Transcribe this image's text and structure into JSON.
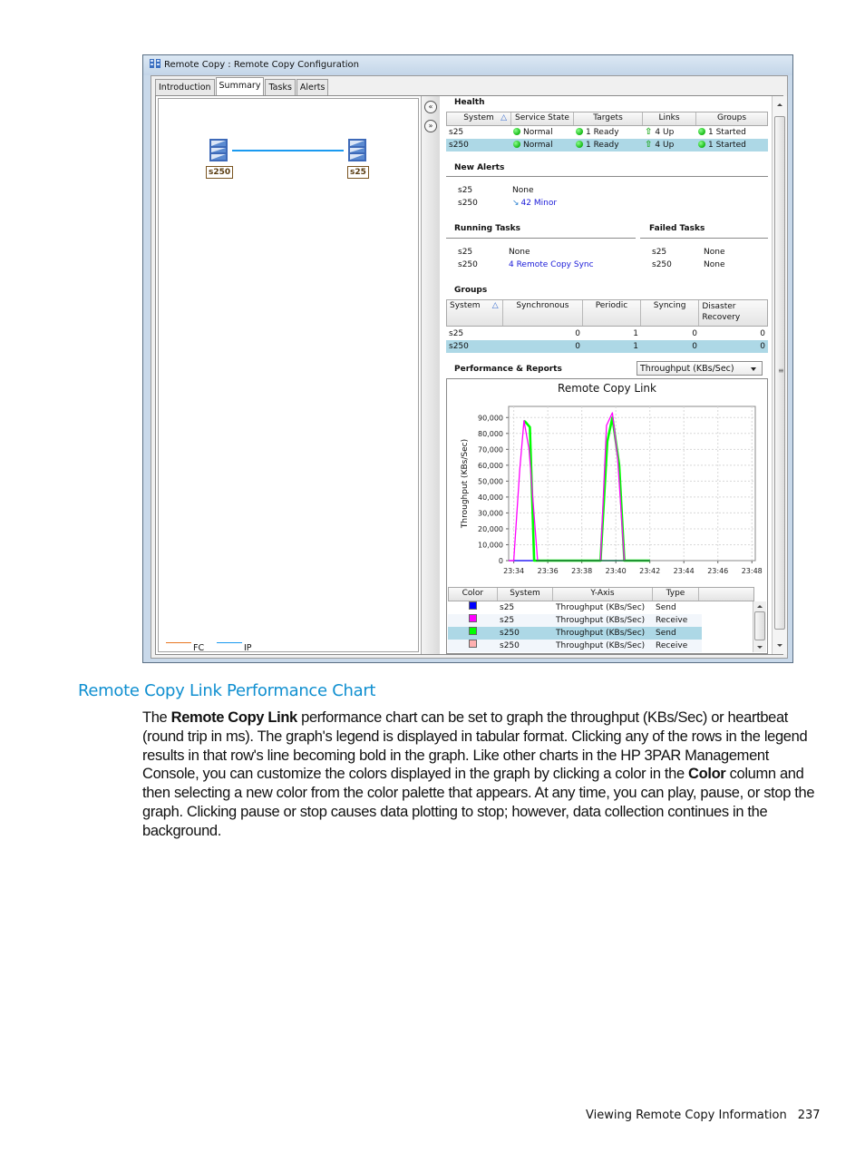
{
  "window": {
    "title": "Remote Copy : Remote Copy Configuration",
    "tabs": [
      {
        "label": "Introduction",
        "active": false
      },
      {
        "label": "Summary",
        "active": true
      },
      {
        "label": "Tasks",
        "active": false
      },
      {
        "label": "Alerts",
        "active": false
      }
    ]
  },
  "topology": {
    "nodes": [
      {
        "label": "s250"
      },
      {
        "label": "s25"
      }
    ],
    "link_type": "IP",
    "legend": [
      {
        "label": "FC",
        "color": "#e87722"
      },
      {
        "label": "IP",
        "color": "#1a9af0"
      }
    ]
  },
  "health": {
    "title": "Health",
    "columns": [
      "System",
      "Service State",
      "Targets",
      "Links",
      "Groups"
    ],
    "rows": [
      {
        "system": "s25",
        "service_state": "Normal",
        "targets": "1 Ready",
        "links": "4 Up",
        "groups": "1 Started",
        "selected": false
      },
      {
        "system": "s250",
        "service_state": "Normal",
        "targets": "1 Ready",
        "links": "4 Up",
        "groups": "1 Started",
        "selected": true
      }
    ]
  },
  "new_alerts": {
    "title": "New Alerts",
    "rows": [
      {
        "system": "s25",
        "value": "None"
      },
      {
        "system": "s250",
        "value": "42 Minor"
      }
    ]
  },
  "running_tasks": {
    "title": "Running Tasks",
    "rows": [
      {
        "system": "s25",
        "value": "None"
      },
      {
        "system": "s250",
        "value": "4 Remote Copy Sync"
      }
    ]
  },
  "failed_tasks": {
    "title": "Failed Tasks",
    "rows": [
      {
        "system": "s25",
        "value": "None"
      },
      {
        "system": "s250",
        "value": "None"
      }
    ]
  },
  "groups": {
    "title": "Groups",
    "columns": [
      "System",
      "Synchronous",
      "Periodic",
      "Syncing",
      "Disaster Recovery"
    ],
    "rows": [
      {
        "system": "s25",
        "synchronous": "0",
        "periodic": "1",
        "syncing": "0",
        "disaster_recovery": "0",
        "selected": false
      },
      {
        "system": "s250",
        "synchronous": "0",
        "periodic": "1",
        "syncing": "0",
        "disaster_recovery": "0",
        "selected": true
      }
    ]
  },
  "performance": {
    "title": "Performance & Reports",
    "metric_select": "Throughput (KBs/Sec)",
    "legend_columns": [
      "Color",
      "System",
      "Y-Axis",
      "Type"
    ],
    "legend_rows": [
      {
        "color": "#0000ff",
        "system": "s25",
        "y_axis": "Throughput (KBs/Sec)",
        "type": "Send",
        "selected": false
      },
      {
        "color": "#ff00ff",
        "system": "s25",
        "y_axis": "Throughput (KBs/Sec)",
        "type": "Receive",
        "selected": false
      },
      {
        "color": "#00ff00",
        "system": "s250",
        "y_axis": "Throughput (KBs/Sec)",
        "type": "Send",
        "selected": true
      },
      {
        "color": "#ffb0b0",
        "system": "s250",
        "y_axis": "Throughput (KBs/Sec)",
        "type": "Receive",
        "selected": false
      }
    ]
  },
  "chart_data": {
    "type": "line",
    "title": "Remote Copy Link",
    "xlabel": "",
    "ylabel": "Throughput (KBs/Sec)",
    "x_ticks": [
      "23:34",
      "23:36",
      "23:38",
      "23:40",
      "23:42",
      "23:44",
      "23:46",
      "23:48"
    ],
    "y_ticks": [
      "0",
      "10,000",
      "20,000",
      "30,000",
      "40,000",
      "50,000",
      "60,000",
      "70,000",
      "80,000",
      "90,000"
    ],
    "xlim_minutes": [
      33.7,
      48.2
    ],
    "ylim": [
      0,
      97000
    ],
    "grid": true,
    "legend": "table-below",
    "series": [
      {
        "name": "s25 Send",
        "color": "#0000ff",
        "x_minutes": [
          33.7,
          42.0
        ],
        "values": [
          0,
          0
        ]
      },
      {
        "name": "s25 Receive",
        "color": "#ff00ff",
        "x_minutes": [
          33.7,
          34.0,
          34.35,
          34.6,
          34.9,
          35.4,
          35.5,
          39.1,
          39.45,
          39.8,
          40.1,
          40.5,
          42.0
        ],
        "values": [
          0,
          0,
          57000,
          88000,
          70000,
          0,
          0,
          0,
          85000,
          93000,
          65000,
          0,
          0
        ]
      },
      {
        "name": "s250 Send",
        "color": "#00ff00",
        "x_minutes": [
          33.7,
          34.6,
          34.7,
          34.95,
          35.2,
          35.3,
          39.1,
          39.5,
          39.8,
          40.2,
          40.5,
          42.0
        ],
        "values": [
          null,
          88000,
          87000,
          84000,
          0,
          0,
          0,
          75000,
          90000,
          60000,
          0,
          0
        ]
      },
      {
        "name": "s250 Receive",
        "color": "#ffb0b0",
        "x_minutes": [
          33.7,
          42.0
        ],
        "values": [
          0,
          0
        ]
      }
    ]
  },
  "document": {
    "heading": "Remote Copy Link Performance Chart",
    "paragraph": [
      {
        "text": "The ",
        "bold": false
      },
      {
        "text": "Remote Copy Link",
        "bold": true
      },
      {
        "text": " performance chart can be set to graph the throughput (KBs/Sec) or heartbeat (round trip in ms). The graph's legend is displayed in tabular format. Clicking any of the rows in the legend results in that row's line becoming bold in the graph. Like other charts in the HP 3PAR Management Console, you can customize the colors displayed in the graph by clicking a color in the ",
        "bold": false
      },
      {
        "text": "Color",
        "bold": true
      },
      {
        "text": " column and then selecting a new color from the color palette that appears. At any time, you can play, pause, or stop the graph. Clicking pause or stop causes data plotting to stop; however, data collection continues in the background.",
        "bold": false
      }
    ],
    "footer_section": "Viewing Remote Copy Information",
    "page_number": "237"
  }
}
